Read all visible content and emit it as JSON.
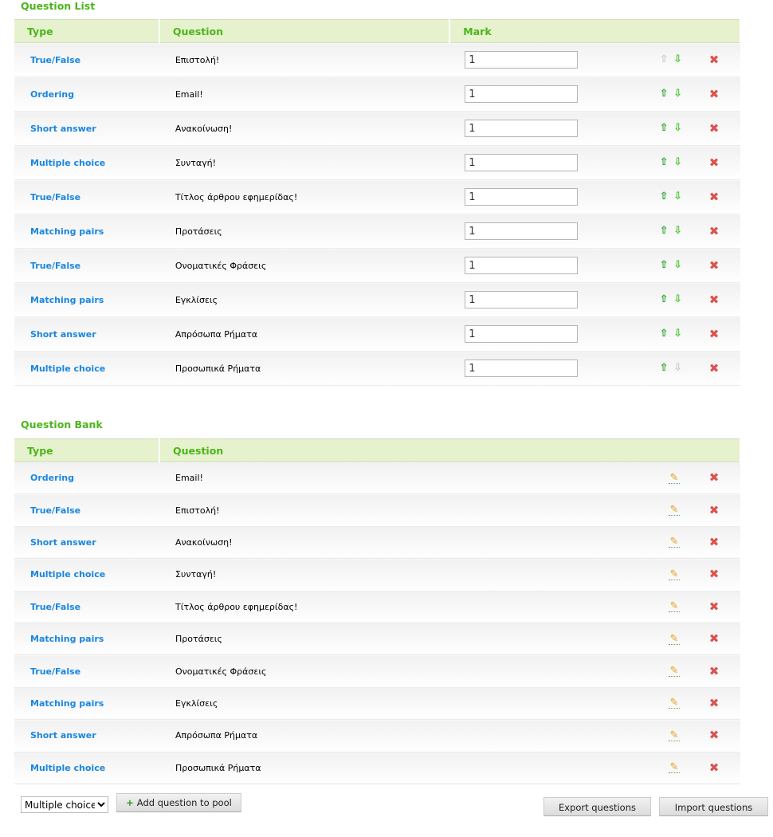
{
  "question_list": {
    "title": "Question List",
    "headers": [
      "Type",
      "Question",
      "Mark"
    ],
    "rows": [
      {
        "type": "True/False",
        "question": "Επιστολή!",
        "mark": "1",
        "up_enabled": false,
        "down_enabled": true
      },
      {
        "type": "Ordering",
        "question": "Email!",
        "mark": "1",
        "up_enabled": true,
        "down_enabled": true
      },
      {
        "type": "Short answer",
        "question": "Ανακοίνωση!",
        "mark": "1",
        "up_enabled": true,
        "down_enabled": true
      },
      {
        "type": "Multiple choice",
        "question": "Συνταγή!",
        "mark": "1",
        "up_enabled": true,
        "down_enabled": true
      },
      {
        "type": "True/False",
        "question": "Τίτλος άρθρου εφημερίδας!",
        "mark": "1",
        "up_enabled": true,
        "down_enabled": true
      },
      {
        "type": "Matching pairs",
        "question": "Προτάσεις",
        "mark": "1",
        "up_enabled": true,
        "down_enabled": true
      },
      {
        "type": "True/False",
        "question": "Ονοματικές Φράσεις",
        "mark": "1",
        "up_enabled": true,
        "down_enabled": true
      },
      {
        "type": "Matching pairs",
        "question": "Εγκλίσεις",
        "mark": "1",
        "up_enabled": true,
        "down_enabled": true
      },
      {
        "type": "Short answer",
        "question": "Απρόσωπα Ρήματα",
        "mark": "1",
        "up_enabled": true,
        "down_enabled": true
      },
      {
        "type": "Multiple choice",
        "question": "Προσωπικά Ρήματα",
        "mark": "1",
        "up_enabled": true,
        "down_enabled": false
      }
    ]
  },
  "question_bank": {
    "title": "Question Bank",
    "headers": [
      "Type",
      "Question"
    ],
    "rows": [
      {
        "type": "Ordering",
        "question": "Email!"
      },
      {
        "type": "True/False",
        "question": "Επιστολή!"
      },
      {
        "type": "Short answer",
        "question": "Ανακοίνωση!"
      },
      {
        "type": "Multiple choice",
        "question": "Συνταγή!"
      },
      {
        "type": "True/False",
        "question": "Τίτλος άρθρου εφημερίδας!"
      },
      {
        "type": "Matching pairs",
        "question": "Προτάσεις"
      },
      {
        "type": "True/False",
        "question": "Ονοματικές Φράσεις"
      },
      {
        "type": "Matching pairs",
        "question": "Εγκλίσεις"
      },
      {
        "type": "Short answer",
        "question": "Απρόσωπα Ρήματα"
      },
      {
        "type": "Multiple choice",
        "question": "Προσωπικά Ρήματα"
      }
    ]
  },
  "footer": {
    "type_select": "Multiple choice",
    "add_label": "Add question to pool",
    "export_label": "Export questions",
    "import_label": "Import questions"
  },
  "icons": {
    "up": "arrow-up-icon",
    "down": "arrow-down-icon",
    "delete": "delete-x-icon",
    "edit": "pencil-icon",
    "add": "plus-icon"
  },
  "colors": {
    "accent_green": "#4cb51c",
    "link_blue": "#1a86e0",
    "header_bg": "#e6f1cd"
  }
}
